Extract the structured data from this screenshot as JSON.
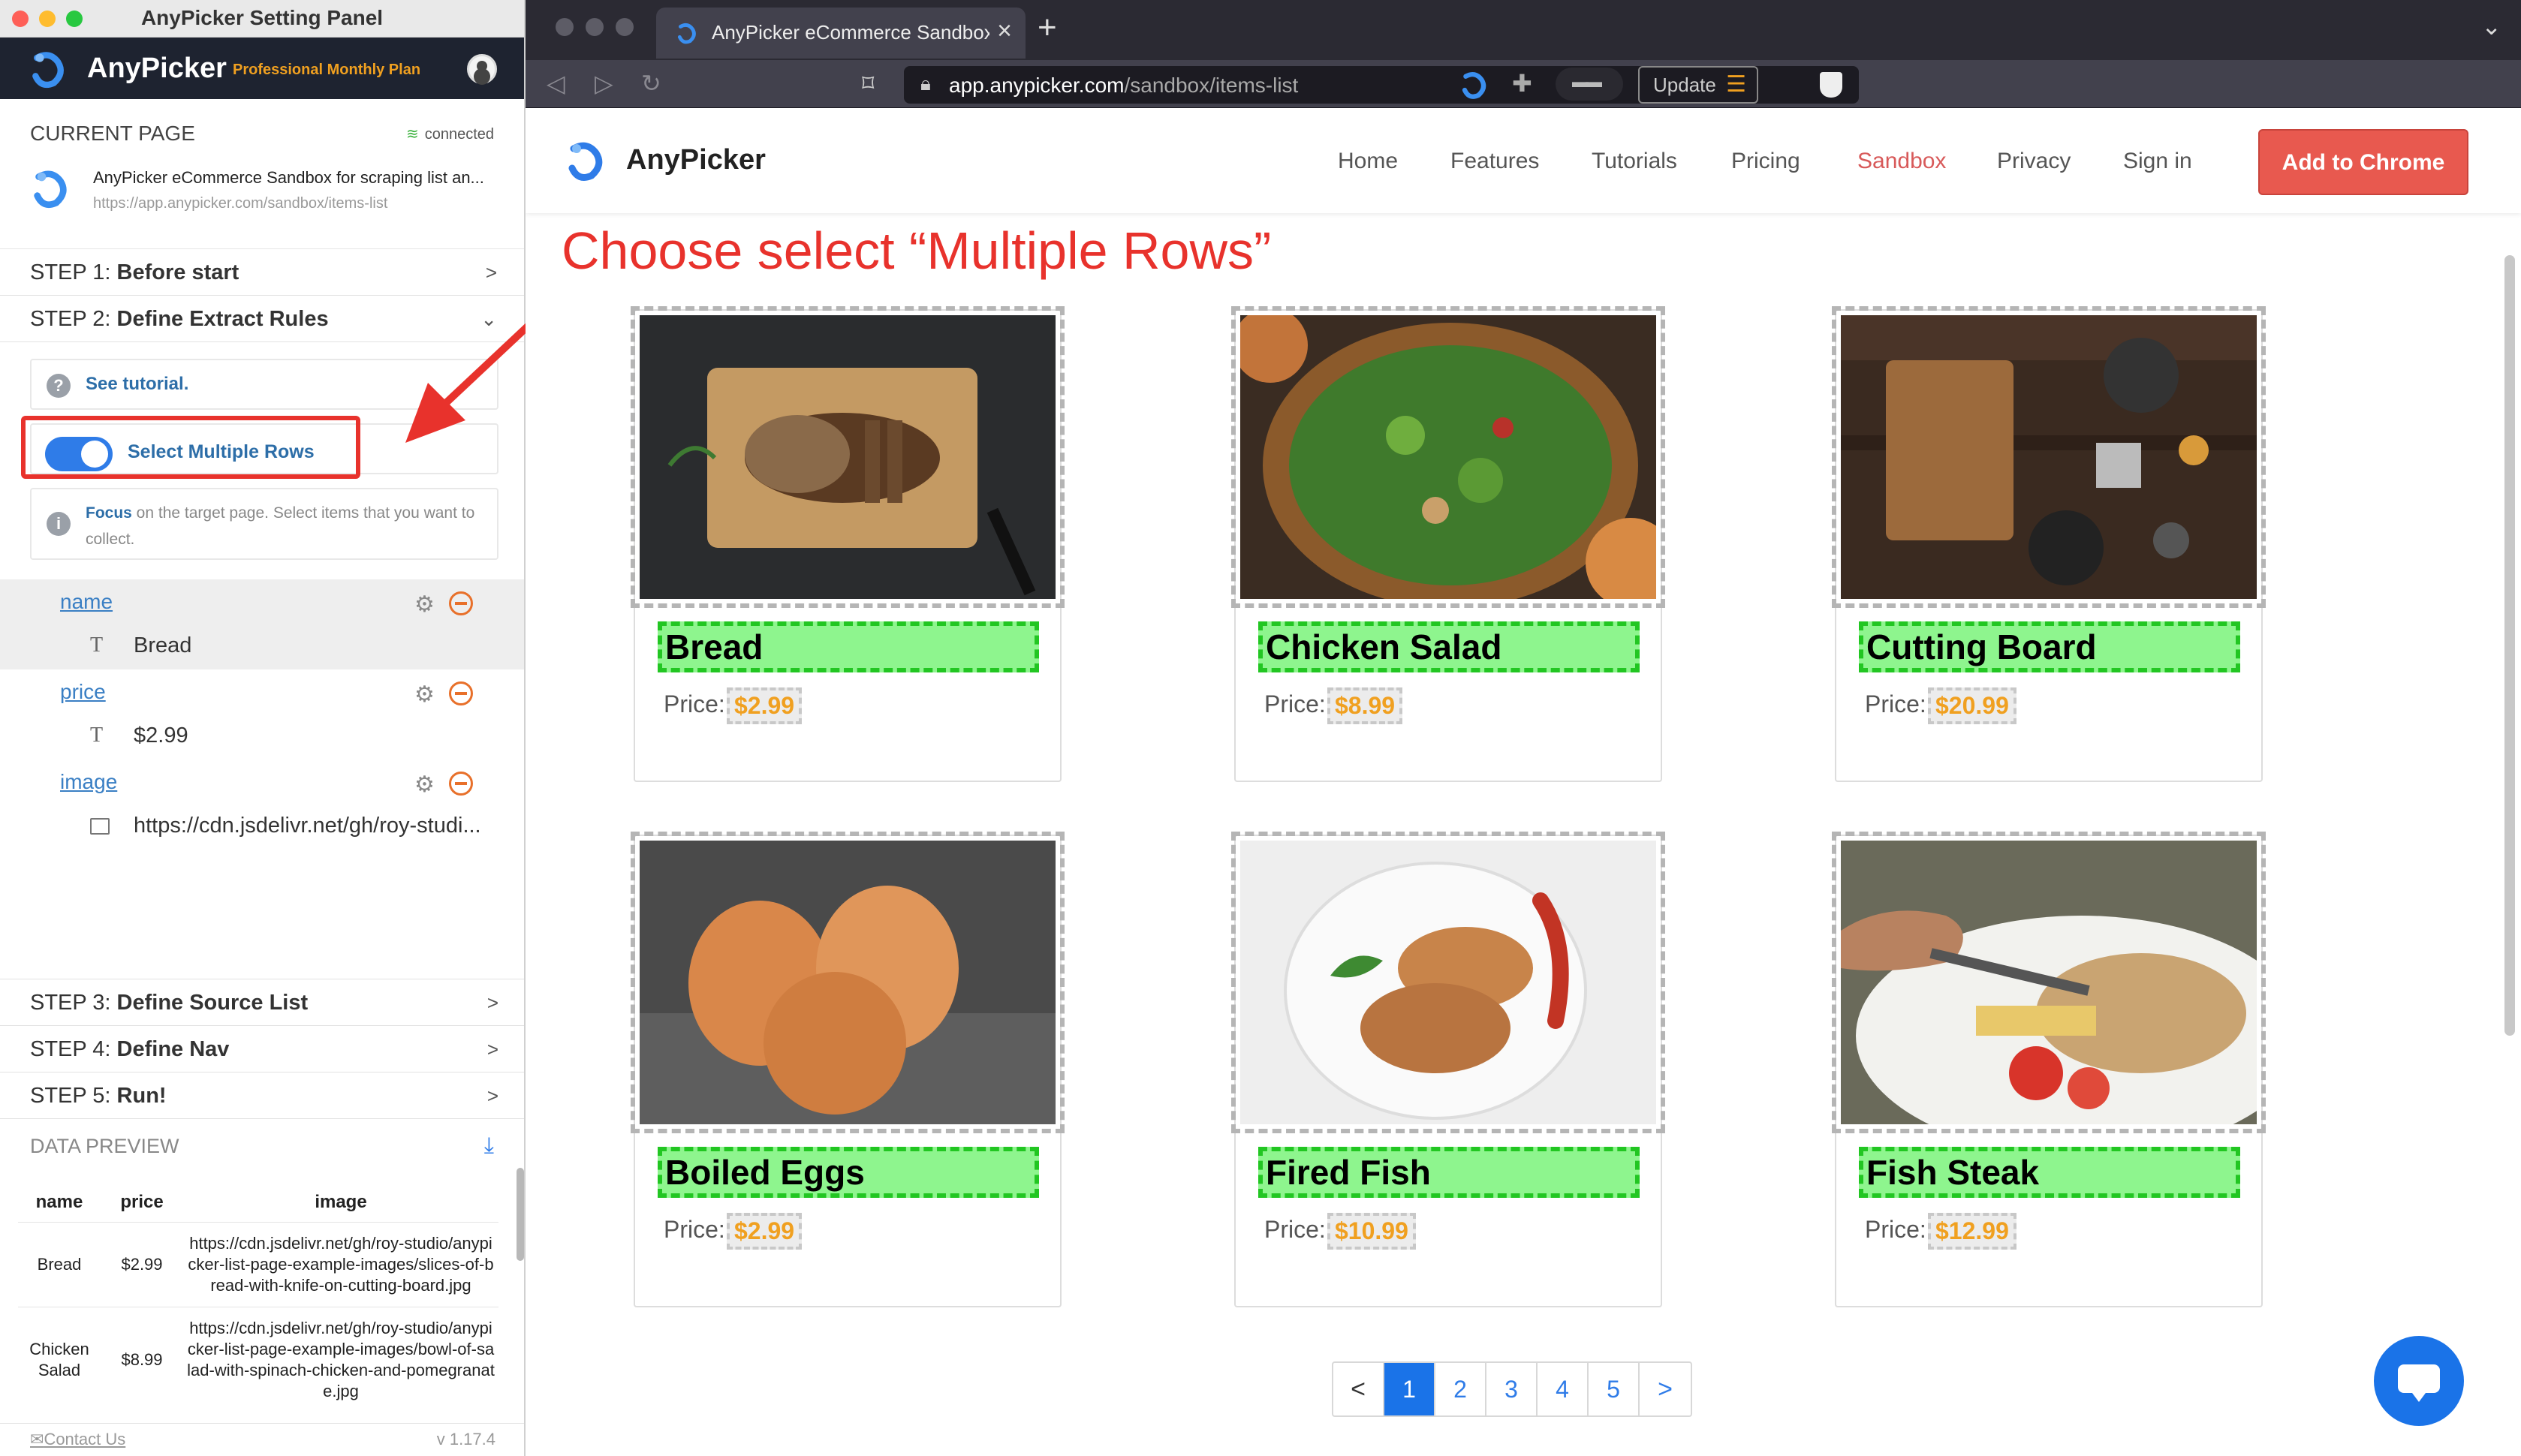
{
  "panel": {
    "window_title": "AnyPicker Setting Panel",
    "app_name": "AnyPicker",
    "plan": "Professional Monthly Plan",
    "current_page": {
      "heading": "CURRENT PAGE",
      "status": "connected",
      "title": "AnyPicker eCommerce Sandbox for scraping list an...",
      "url": "https://app.anypicker.com/sandbox/items-list"
    },
    "steps": [
      {
        "num": "STEP 1:",
        "label": "Before start",
        "chevron": ">"
      },
      {
        "num": "STEP 2:",
        "label": "Define Extract Rules",
        "chevron": "v"
      },
      {
        "num": "STEP 3:",
        "label": "Define Source List",
        "chevron": ">"
      },
      {
        "num": "STEP 4:",
        "label": "Define Nav",
        "chevron": ">"
      },
      {
        "num": "STEP 5:",
        "label": "Run!",
        "chevron": ">"
      }
    ],
    "tutorial_link": "See tutorial.",
    "multi_rows": {
      "label": "Select Multiple Rows",
      "enabled": true
    },
    "focus_hint": {
      "bold": "Focus",
      "rest": " on the target page. Select items that you want to collect."
    },
    "fields": [
      {
        "name": "name",
        "type_icon": "text-icon",
        "value": "Bread"
      },
      {
        "name": "price",
        "type_icon": "text-icon",
        "value": "$2.99"
      },
      {
        "name": "image",
        "type_icon": "image-icon",
        "value": "https://cdn.jsdelivr.net/gh/roy-studi..."
      }
    ],
    "data_preview": {
      "heading": "DATA PREVIEW",
      "columns": [
        "name",
        "price",
        "image"
      ],
      "rows": [
        {
          "name": "Bread",
          "price": "$2.99",
          "image": "https://cdn.jsdelivr.net/gh/roy-studio/anypicker-list-page-example-images/slices-of-bread-with-knife-on-cutting-board.jpg"
        },
        {
          "name": "Chicken Salad",
          "price": "$8.99",
          "image": "https://cdn.jsdelivr.net/gh/roy-studio/anypicker-list-page-example-images/bowl-of-salad-with-spinach-chicken-and-pomegranate.jpg"
        }
      ]
    },
    "footer": {
      "contact": "Contact Us",
      "version": "v 1.17.4"
    }
  },
  "browser": {
    "tab_title": "AnyPicker eCommerce Sandbox",
    "tab_close": "×",
    "new_tab": "+",
    "url_host": "app.anypicker.com",
    "url_path": "/sandbox/items-list",
    "update_label": "Update"
  },
  "site": {
    "brand": "AnyPicker",
    "nav": [
      "Home",
      "Features",
      "Tutorials",
      "Pricing",
      "Sandbox",
      "Privacy",
      "Sign in"
    ],
    "active_nav": "Sandbox",
    "cta": "Add to Chrome",
    "instruction": "Choose select “Multiple Rows”",
    "price_label": "Price:",
    "products": [
      {
        "name": "Bread",
        "price": "$2.99"
      },
      {
        "name": "Chicken Salad",
        "price": "$8.99"
      },
      {
        "name": "Cutting Board",
        "price": "$20.99"
      },
      {
        "name": "Boiled Eggs",
        "price": "$2.99"
      },
      {
        "name": "Fired Fish",
        "price": "$10.99"
      },
      {
        "name": "Fish Steak",
        "price": "$12.99"
      }
    ],
    "pagination": {
      "prev": "<",
      "pages": [
        "1",
        "2",
        "3",
        "4",
        "5"
      ],
      "current": "1",
      "next": ">"
    }
  },
  "colors": {
    "accent": "#1a73e8",
    "highlight_green": "#8ef58e",
    "annotation_red": "#e8322c",
    "cta_red": "#e8594f",
    "price_orange": "#f0a020"
  }
}
